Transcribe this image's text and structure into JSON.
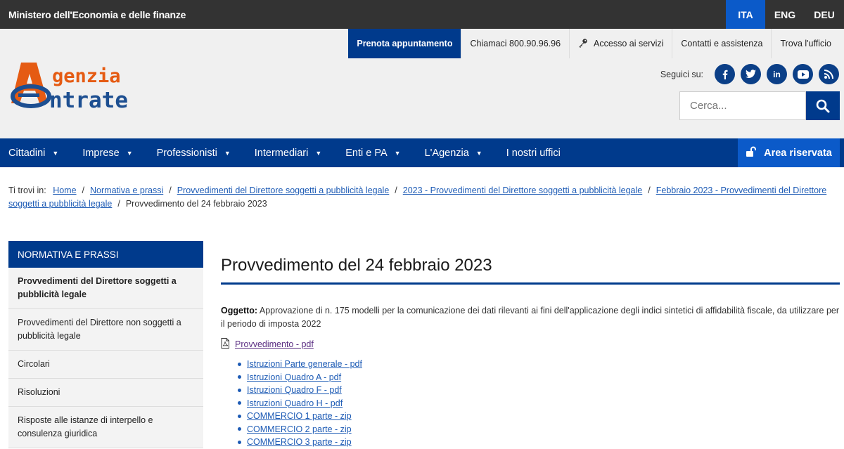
{
  "topbar": {
    "ministry": "Ministero dell'Economia e delle finanze",
    "langs": [
      "ITA",
      "ENG",
      "DEU"
    ]
  },
  "utility": {
    "booking": "Prenota appuntamento",
    "call": "Chiamaci 800.90.96.96",
    "services": "Accesso ai servizi",
    "contacts": "Contatti e assistenza",
    "office": "Trova l'ufficio"
  },
  "logo": {
    "line1": "genzia",
    "line2": "ntrate"
  },
  "social": {
    "label": "Seguici su:",
    "items": [
      "facebook",
      "twitter",
      "linkedin",
      "youtube",
      "rss"
    ]
  },
  "search": {
    "placeholder": "Cerca..."
  },
  "nav": {
    "items": [
      "Cittadini",
      "Imprese",
      "Professionisti",
      "Intermediari",
      "Enti e PA",
      "L'Agenzia",
      "I nostri uffici"
    ],
    "reserved": "Area riservata"
  },
  "breadcrumb": {
    "prefix": "Ti trovi in:",
    "links": [
      "Home",
      "Normativa e prassi",
      "Provvedimenti del Direttore soggetti a pubblicità legale",
      "2023 - Provvedimenti del Direttore soggetti a pubblicità legale",
      "Febbraio 2023 - Provvedimenti del Direttore soggetti a pubblicità legale"
    ],
    "current": "Provvedimento del 24 febbraio 2023"
  },
  "sidebar": {
    "title": "NORMATIVA E PRASSI",
    "items": [
      "Provvedimenti del Direttore soggetti a pubblicità legale",
      "Provvedimenti del Direttore non soggetti a pubblicità legale",
      "Circolari",
      "Risoluzioni",
      "Risposte alle istanze di interpello e consulenza giuridica"
    ]
  },
  "main": {
    "title": "Provvedimento del 24 febbraio 2023",
    "subject_label": "Oggetto:",
    "subject_text": " Approvazione di n. 175 modelli per la comunicazione dei dati rilevanti ai fini dell'applicazione degli indici sintetici di affidabilità fiscale, da utilizzare per il periodo di imposta 2022",
    "pdf_link": "Provvedimento - pdf",
    "links": [
      "Istruzioni Parte generale - pdf",
      "Istruzioni Quadro A - pdf",
      "Istruzioni Quadro F - pdf",
      "Istruzioni Quadro H - pdf",
      "COMMERCIO 1 parte - zip",
      "COMMERCIO 2 parte - zip",
      "COMMERCIO 3 parte - zip"
    ]
  },
  "colors": {
    "primary": "#003a8c",
    "accent": "#0b5ac9",
    "logo_orange": "#e55b13"
  }
}
